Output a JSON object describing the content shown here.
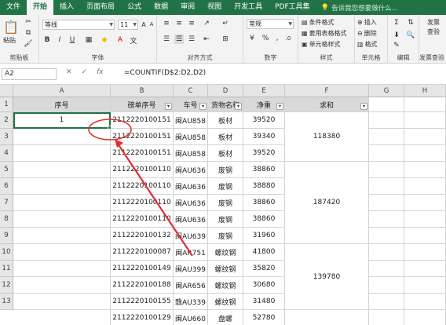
{
  "tabs": [
    "文件",
    "开始",
    "插入",
    "页面布局",
    "公式",
    "数据",
    "审阅",
    "视图",
    "开发工具",
    "PDF工具集"
  ],
  "tell_me": "告诉我您想要做什么...",
  "ribbon": {
    "paste": "粘贴",
    "clipboard": "剪贴板",
    "font_name": "等线",
    "font_size": "11",
    "bold": "B",
    "italic": "I",
    "underline": "U",
    "font_group": "字体",
    "align_group": "对齐方式",
    "number_format": "常规",
    "percent": "%",
    "comma": ",",
    "number_group": "数字",
    "cond_format": "条件格式",
    "table_format": "套用表格格式",
    "cell_style": "单元格样式",
    "style_group": "样式",
    "insert": "插入",
    "delete": "删除",
    "format": "格式",
    "cells_group": "单元格",
    "edit_group": "编辑",
    "send_invoice": "发票",
    "send_invoice2": "查验",
    "invoice_group": "发票查验"
  },
  "formula_bar": {
    "name_box": "A2",
    "fx": "fx",
    "formula": "=COUNTIF(D$2:D2,D2)"
  },
  "columns": [
    "A",
    "B",
    "C",
    "D",
    "E",
    "F",
    "G",
    "H"
  ],
  "rows": [
    "1",
    "2",
    "3",
    "4",
    "5",
    "6",
    "7",
    "8",
    "9",
    "10",
    "11",
    "12",
    "13"
  ],
  "headers": {
    "A": "序号",
    "B": "磅单序号",
    "C": "车号",
    "D": "货物名称",
    "E": "净重",
    "F": "求和"
  },
  "data": [
    {
      "A": "1",
      "B": "2112220100151",
      "C": "闽AU858",
      "D": "板材",
      "E": "39520"
    },
    {
      "A": "",
      "B": "2112220100151",
      "C": "闽AU858",
      "D": "板材",
      "E": "39340"
    },
    {
      "A": "",
      "B": "2112220100151",
      "C": "闽AU858",
      "D": "板材",
      "E": "39520"
    },
    {
      "A": "",
      "B": "2112220100110",
      "C": "闽AU636",
      "D": "废钢",
      "E": "38860"
    },
    {
      "A": "",
      "B": "2112220100110",
      "C": "闽AU636",
      "D": "废钢",
      "E": "38880"
    },
    {
      "A": "",
      "B": "2112220100110",
      "C": "闽AU636",
      "D": "废钢",
      "E": "38860"
    },
    {
      "A": "",
      "B": "2112220100110",
      "C": "闽AU636",
      "D": "废钢",
      "E": "38860"
    },
    {
      "A": "",
      "B": "2112220100132",
      "C": "闽AU639",
      "D": "废钢",
      "E": "31960"
    },
    {
      "A": "",
      "B": "2112220100087",
      "C": "闽AR751",
      "D": "螺纹钢",
      "E": "41800"
    },
    {
      "A": "",
      "B": "2112220100149",
      "C": "闽AU399",
      "D": "螺纹钢",
      "E": "35820"
    },
    {
      "A": "",
      "B": "2112220100188",
      "C": "闽AR656",
      "D": "螺纹钢",
      "E": "30680"
    },
    {
      "A": "",
      "B": "2112220100155",
      "C": "赣AU339",
      "D": "螺纹钢",
      "E": "31480"
    },
    {
      "A": "",
      "B": "2112220100129",
      "C": "闽AU660",
      "D": "盘螺",
      "E": "52780"
    }
  ],
  "sums": [
    "118380",
    "187420",
    "139780"
  ],
  "colors": {
    "excel_green": "#217346",
    "annotation_red": "#e03030"
  }
}
